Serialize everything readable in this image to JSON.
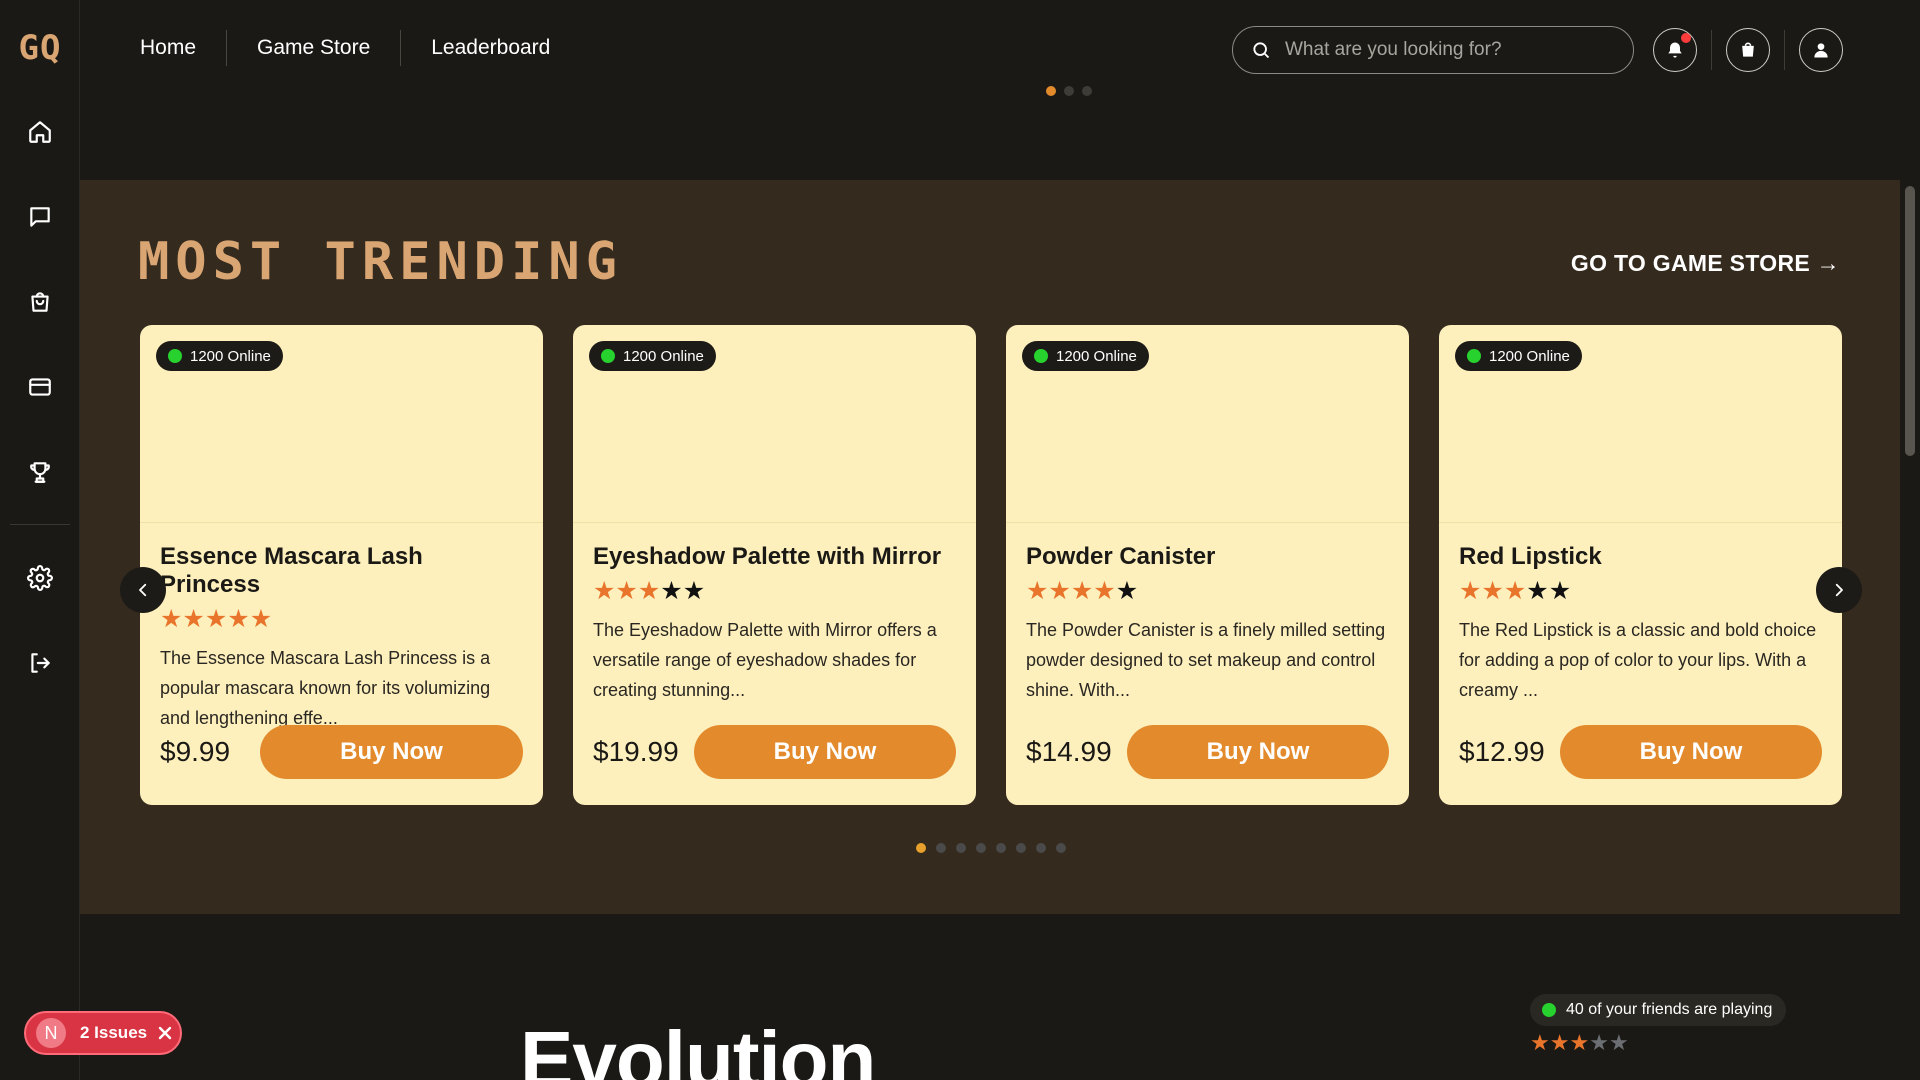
{
  "app": {
    "logo_text": "GQ"
  },
  "sidebar": {
    "items": [
      {
        "name": "home",
        "icon": "home-icon"
      },
      {
        "name": "chat",
        "icon": "chat-icon"
      },
      {
        "name": "store",
        "icon": "shopping-bag-icon"
      },
      {
        "name": "payments",
        "icon": "credit-card-icon"
      },
      {
        "name": "leaderboard",
        "icon": "trophy-icon"
      },
      {
        "name": "settings",
        "icon": "gear-icon"
      },
      {
        "name": "logout",
        "icon": "logout-icon"
      }
    ]
  },
  "nav": {
    "items": [
      {
        "label": "Home"
      },
      {
        "label": "Game Store"
      },
      {
        "label": "Leaderboard"
      }
    ]
  },
  "search": {
    "placeholder": "What are you looking for?",
    "value": ""
  },
  "header_actions": [
    {
      "name": "notifications",
      "icon": "bell-icon",
      "has_badge": true
    },
    {
      "name": "cart",
      "icon": "cart-icon"
    },
    {
      "name": "profile",
      "icon": "user-icon"
    }
  ],
  "banner_dots": {
    "count": 3,
    "active": 0
  },
  "trending": {
    "title": "MOST TRENDING",
    "store_link": "GO TO GAME STORE →",
    "cards": [
      {
        "online": "1200 Online",
        "title": "Essence Mascara Lash Princess",
        "rating": 5,
        "description": "The Essence Mascara Lash Princess is a popular mascara known for its volumizing and lengthening effe...",
        "price": "$9.99",
        "button": "Buy Now"
      },
      {
        "online": "1200 Online",
        "title": "Eyeshadow Palette with Mirror",
        "rating": 3,
        "description": "The Eyeshadow Palette with Mirror offers a versatile range of eyeshadow shades for creating stunning...",
        "price": "$19.99",
        "button": "Buy Now"
      },
      {
        "online": "1200 Online",
        "title": "Powder Canister",
        "rating": 4,
        "description": "The Powder Canister is a finely milled setting powder designed to set makeup and control shine. With...",
        "price": "$14.99",
        "button": "Buy Now"
      },
      {
        "online": "1200 Online",
        "title": "Red Lipstick",
        "rating": 3,
        "description": "The Red Lipstick is a classic and bold choice for adding a pop of color to your lips. With a creamy ...",
        "price": "$12.99",
        "button": "Buy Now"
      }
    ],
    "pagination": {
      "count": 8,
      "active": 0
    }
  },
  "evolution": {
    "title": "Evolution",
    "friends_text": "40 of your friends are playing",
    "rating": 3,
    "rating_max": 5
  },
  "issues": {
    "logo": "N",
    "label": "2 Issues"
  },
  "colors": {
    "accent": "#e38b2c",
    "star": "#e8752b",
    "card_bg": "#fdf0bd",
    "section_bg": "#352a1e",
    "page_bg": "#1b1915",
    "online": "#27d12e",
    "title": "#d9a673"
  }
}
